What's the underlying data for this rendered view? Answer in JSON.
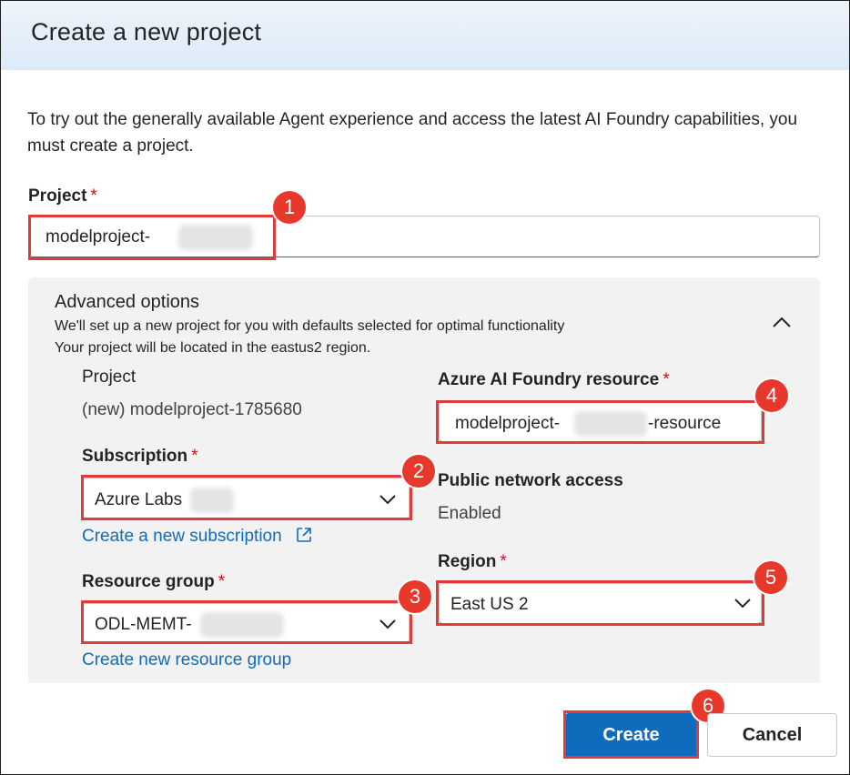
{
  "dialog": {
    "title": "Create a new project",
    "intro": "To try out the generally available Agent experience and access the latest AI Foundry capabilities, you must create a project."
  },
  "project_field": {
    "label": "Project",
    "required_mark": "*",
    "value": "modelproject-"
  },
  "advanced": {
    "title": "Advanced options",
    "note_1": "We'll set up a new project for you with defaults selected for optimal functionality",
    "note_2": "Your project will be located in the eastus2 region.",
    "project_label": "Project",
    "project_value": "(new) modelproject-1785680",
    "subscription_label": "Subscription",
    "subscription_value": "Azure Labs",
    "create_subscription_link": "Create a new subscription",
    "resource_group_label": "Resource group",
    "resource_group_value": "ODL-MEMT-",
    "create_resource_group_link": "Create new resource group",
    "foundry_label": "Azure AI Foundry resource",
    "foundry_value_prefix": "modelproject-",
    "foundry_value_suffix": "-resource",
    "network_label": "Public network access",
    "network_value": "Enabled",
    "region_label": "Region",
    "region_value": "East US 2",
    "required_mark": "*"
  },
  "buttons": {
    "create": "Create",
    "cancel": "Cancel"
  },
  "annotations": [
    "1",
    "2",
    "3",
    "4",
    "5",
    "6"
  ],
  "colors": {
    "accent": "#0f6cbd",
    "highlight": "#e03b3b",
    "badge": "#e8382c",
    "required": "#c50f1f"
  }
}
